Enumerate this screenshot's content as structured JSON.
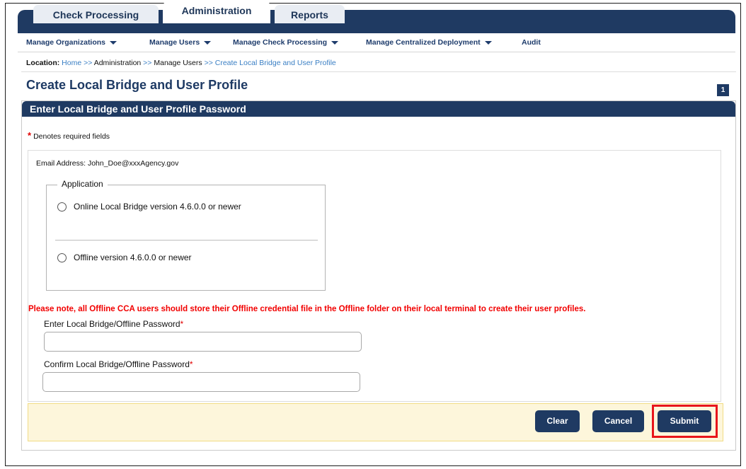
{
  "tabs": [
    {
      "label": "Check Processing"
    },
    {
      "label": "Administration"
    },
    {
      "label": "Reports"
    }
  ],
  "menu": [
    {
      "label": "Manage Organizations"
    },
    {
      "label": "Manage Users"
    },
    {
      "label": "Manage Check Processing"
    },
    {
      "label": "Manage Centralized Deployment"
    },
    {
      "label": "Audit"
    }
  ],
  "location": {
    "label": "Location:",
    "crumbs": [
      "Home",
      ">>",
      "Administration",
      ">>",
      "Manage Users",
      ">>",
      "Create Local Bridge and User Profile"
    ]
  },
  "page": {
    "title": "Create Local Bridge and User Profile",
    "badge": "1"
  },
  "panel": {
    "header": "Enter Local Bridge and User Profile Password",
    "required_star": "*",
    "required_note": "Denotes required fields",
    "email_line": "Email Address: John_Doe@xxxAgency.gov"
  },
  "application": {
    "legend": "Application",
    "options": [
      {
        "label": "Online Local Bridge version 4.6.0.0 or newer"
      },
      {
        "label": "Offline version 4.6.0.0 or newer"
      }
    ]
  },
  "notice": "Please note, all Offline CCA users should store their Offline credential file in the Offline folder on their local terminal to create their user profiles.",
  "fields": {
    "password_label": "Enter Local Bridge/Offline Password",
    "password_value": "",
    "confirm_label": "Confirm Local Bridge/Offline Password",
    "confirm_value": "",
    "star": "*"
  },
  "buttons": {
    "clear": "Clear",
    "cancel": "Cancel",
    "submit": "Submit"
  },
  "colors": {
    "navy": "#1f3a62",
    "link": "#3a7fc4",
    "required_red": "#e00000",
    "highlight_red": "#e8151b",
    "button_bar_bg": "#fdf6db"
  }
}
